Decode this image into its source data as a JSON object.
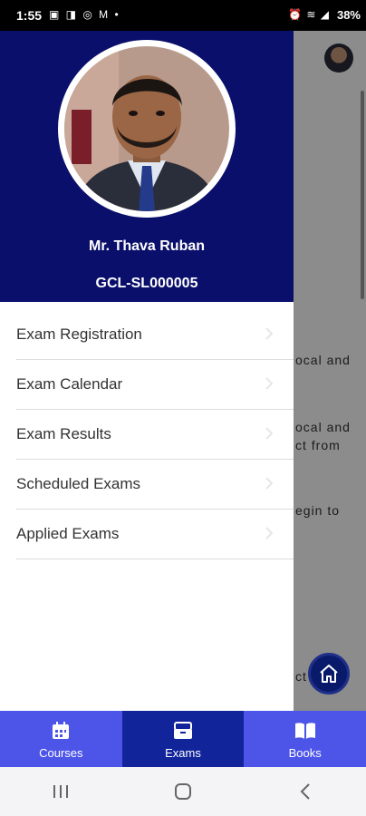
{
  "status_bar": {
    "time": "1:55",
    "left_icons": "▣ ◨ ◎ M •",
    "right_icons": "⏰ ≋ ◢",
    "battery": "38%"
  },
  "background_page": {
    "text_lines": [
      "ocal  and",
      "ocal  and",
      "ct  from",
      "egin  to",
      "ct"
    ]
  },
  "drawer": {
    "profile": {
      "name": "Mr. Thava Ruban",
      "id": "GCL-SL000005"
    },
    "menu_items": [
      {
        "label": "Exam Registration"
      },
      {
        "label": "Exam Calendar"
      },
      {
        "label": "Exam Results"
      },
      {
        "label": "Scheduled Exams"
      },
      {
        "label": "Applied Exams"
      }
    ]
  },
  "bottom_nav": {
    "tabs": [
      {
        "label": "Courses",
        "icon": "calendar-icon"
      },
      {
        "label": "Exams",
        "icon": "archive-box-icon"
      },
      {
        "label": "Books",
        "icon": "open-book-icon"
      }
    ],
    "active": "Exams"
  },
  "colors": {
    "drawer_header": "#0a0f6b",
    "bottom_nav": "#4d55e8",
    "bottom_nav_active": "#11249a"
  }
}
